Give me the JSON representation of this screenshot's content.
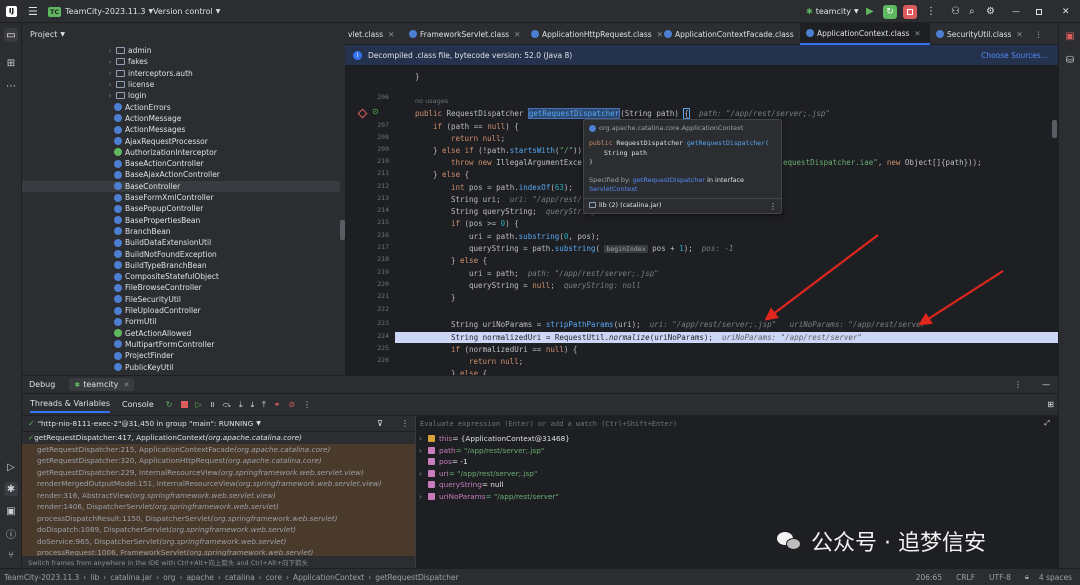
{
  "titlebar": {
    "project_badge": "TC",
    "project_name": "TeamCity-2023.11.3",
    "vcs": "Version control",
    "run_config": "teamcity"
  },
  "project_panel": {
    "title": "Project",
    "items": [
      {
        "label": "admin",
        "kind": "folder"
      },
      {
        "label": "fakes",
        "kind": "folder"
      },
      {
        "label": "interceptors.auth",
        "kind": "folder"
      },
      {
        "label": "license",
        "kind": "folder"
      },
      {
        "label": "login",
        "kind": "folder"
      },
      {
        "label": "ActionErrors",
        "kind": "class"
      },
      {
        "label": "ActionMessage",
        "kind": "class"
      },
      {
        "label": "ActionMessages",
        "kind": "class"
      },
      {
        "label": "AjaxRequestProcessor",
        "kind": "class"
      },
      {
        "label": "AuthorizationInterceptor",
        "kind": "interface"
      },
      {
        "label": "BaseActionController",
        "kind": "class"
      },
      {
        "label": "BaseAjaxActionController",
        "kind": "class"
      },
      {
        "label": "BaseController",
        "kind": "class"
      },
      {
        "label": "BaseFormXmlController",
        "kind": "class"
      },
      {
        "label": "BasePopupController",
        "kind": "class"
      },
      {
        "label": "BasePropertiesBean",
        "kind": "class"
      },
      {
        "label": "BranchBean",
        "kind": "class"
      },
      {
        "label": "BuildDataExtensionUtil",
        "kind": "class"
      },
      {
        "label": "BuildNotFoundException",
        "kind": "class"
      },
      {
        "label": "BuildTypeBranchBean",
        "kind": "class"
      },
      {
        "label": "CompositeStatefulObject",
        "kind": "class"
      },
      {
        "label": "FileBrowseController",
        "kind": "class"
      },
      {
        "label": "FileSecurityUtil",
        "kind": "class"
      },
      {
        "label": "FileUploadController",
        "kind": "class"
      },
      {
        "label": "FormUtil",
        "kind": "class"
      },
      {
        "label": "GetActionAllowed",
        "kind": "interface"
      },
      {
        "label": "MultipartFormController",
        "kind": "class"
      },
      {
        "label": "ProjectFinder",
        "kind": "class"
      },
      {
        "label": "PublicKeyUtil",
        "kind": "class"
      }
    ]
  },
  "editor": {
    "tabs": [
      {
        "label": "vlet.class"
      },
      {
        "label": "FrameworkServlet.class"
      },
      {
        "label": "ApplicationHttpRequest.class"
      },
      {
        "label": "ApplicationContextFacade.class"
      },
      {
        "label": "ApplicationContext.class",
        "active": true
      },
      {
        "label": "SecurityUtil.class"
      }
    ],
    "banner_text": "Decompiled .class file, bytecode version: 52.0 (Java 8)",
    "banner_link": "Choose Sources...",
    "line_numbers": [
      "",
      "206",
      "",
      "207",
      "208",
      "209",
      "210",
      "211",
      "212",
      "213",
      "214",
      "215",
      "216",
      "217",
      "218",
      "219",
      "220",
      "221",
      "222",
      "223",
      "224",
      "225",
      "226"
    ],
    "usage_hint": "no usages"
  },
  "popup": {
    "package": "org.apache.catalina.core.ApplicationContext",
    "signature_kw": "public",
    "signature_type": "RequestDispatcher",
    "signature_name": "getRequestDispatcher(",
    "param": "String path",
    "close_paren": ")",
    "specified_label": "Specified by:",
    "specified_method": "getRequestDispatcher",
    "specified_in": "in interface",
    "specified_iface": "ServletContext",
    "lib": "lib (2) (catalina.jar)"
  },
  "debug": {
    "tab_debug": "Debug",
    "tab_session": "teamcity",
    "tab_threads": "Threads & Variables",
    "tab_console": "Console",
    "thread": "\"http-nio-8111-exec-2\"@31,450 in group \"main\": RUNNING",
    "eval_placeholder": "Evaluate expression (Enter) or add a watch (Ctrl+Shift+Enter)",
    "frames": [
      {
        "text": "getRequestDispatcher:417, ApplicationContext ",
        "pkg": "(org.apache.catalina.core)"
      },
      {
        "text": "getRequestDispatcher:215, ApplicationContextFacade ",
        "pkg": "(org.apache.catalina.core)"
      },
      {
        "text": "getRequestDispatcher:320, ApplicationHttpRequest ",
        "pkg": "(org.apache.catalina.core)"
      },
      {
        "text": "getRequestDispatcher:229, InternalResourceView ",
        "pkg": "(org.springframework.web.servlet.view)"
      },
      {
        "text": "renderMergedOutputModel:151, InternalResourceView ",
        "pkg": "(org.springframework.web.servlet.view)"
      },
      {
        "text": "render:316, AbstractView ",
        "pkg": "(org.springframework.web.servlet.view)"
      },
      {
        "text": "render:1406, DispatcherServlet ",
        "pkg": "(org.springframework.web.servlet)"
      },
      {
        "text": "processDispatchResult:1150, DispatcherServlet ",
        "pkg": "(org.springframework.web.servlet)"
      },
      {
        "text": "doDispatch:1089, DispatcherServlet ",
        "pkg": "(org.springframework.web.servlet)"
      },
      {
        "text": "doService:965, DispatcherServlet ",
        "pkg": "(org.springframework.web.servlet)"
      },
      {
        "text": "processRequest:1006, FrameworkServlet ",
        "pkg": "(org.springframework.web.servlet)"
      }
    ],
    "frames_hint": "Switch frames from anywhere in the IDE with Ctrl+Alt+向上箭头 and Ctrl+Alt+向下箭头",
    "variables": [
      {
        "name": "this",
        "value": " = {ApplicationContext@31468}",
        "expand": true
      },
      {
        "name": "path",
        "value": " = \"/app/rest/server;.jsp\"",
        "expand": true
      },
      {
        "name": "pos",
        "value": " = -1",
        "expand": false
      },
      {
        "name": "uri",
        "value": " = \"/app/rest/server;.jsp\"",
        "expand": true
      },
      {
        "name": "queryString",
        "value": " = null",
        "expand": false
      },
      {
        "name": "uriNoParams",
        "value": " = \"/app/rest/server\"",
        "expand": true
      }
    ]
  },
  "statusbar": {
    "crumbs": [
      "TeamCity-2023.11.3",
      "lib",
      "catalina.jar",
      "org",
      "apache",
      "catalina",
      "core",
      "ApplicationContext",
      "getRequestDispatcher"
    ],
    "position": "206:65",
    "line_sep": "CRLF",
    "encoding": "UTF-8",
    "indent": "4 spaces"
  },
  "watermark": "公众号 · 追梦信安",
  "colors": {
    "accent": "#3574f0",
    "arrow": "#e0261d",
    "selected_line": "#ccd6f6"
  }
}
